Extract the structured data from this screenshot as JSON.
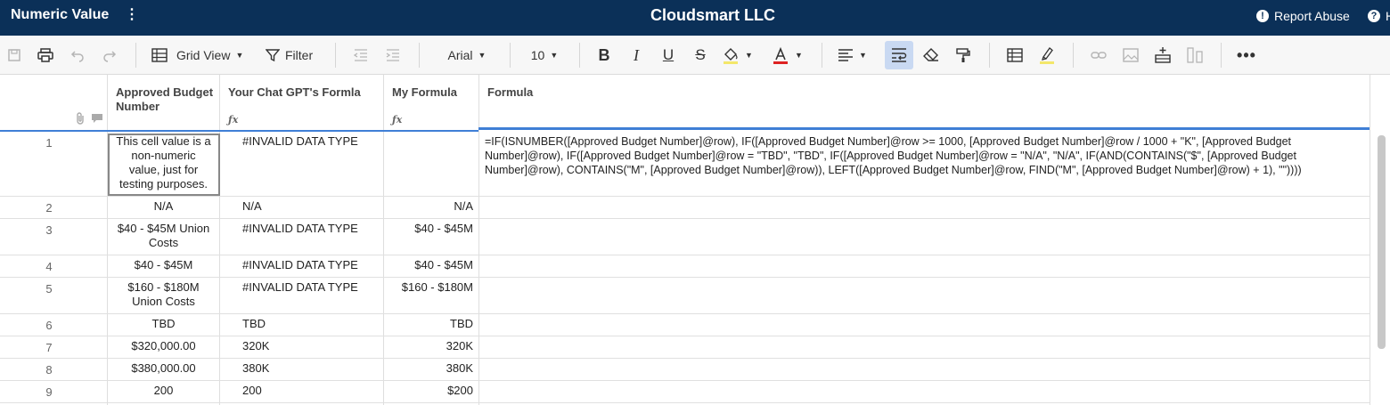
{
  "header": {
    "sheet_name": "Numeric Value",
    "company": "Cloudsmart LLC",
    "report_abuse": "Report Abuse",
    "help_letter": "H"
  },
  "toolbar": {
    "view_label": "Grid View",
    "filter_label": "Filter",
    "font": "Arial",
    "size": "10"
  },
  "columns": [
    {
      "title_line1": "Approved Budget",
      "title_line2": "Number"
    },
    {
      "title_line1": "Your Chat GPT's Formla"
    },
    {
      "title_line1": "My Formula"
    },
    {
      "title_line1": "Formula"
    }
  ],
  "rows": [
    {
      "num": "1",
      "c1": [
        "This cell value is a",
        "non-numeric",
        "value, just for",
        "testing purposes."
      ],
      "c2": "#INVALID DATA TYPE",
      "c3": "",
      "c4": [
        "=IF(ISNUMBER([Approved Budget Number]@row), IF([Approved Budget Number]@row >= 1000, [Approved Budget Number]@row / 1000 + \"K\", [Approved Budget",
        "Number]@row), IF([Approved Budget Number]@row = \"TBD\", \"TBD\", IF([Approved Budget Number]@row = \"N/A\", \"N/A\", IF(AND(CONTAINS(\"$\", [Approved Budget",
        "Number]@row), CONTAINS(\"M\", [Approved Budget Number]@row)), LEFT([Approved Budget Number]@row, FIND(\"M\", [Approved Budget Number]@row) + 1), \"\"))))"
      ]
    },
    {
      "num": "2",
      "c1": [
        "N/A"
      ],
      "c2": "N/A",
      "c3": "N/A"
    },
    {
      "num": "3",
      "c1": [
        "$40 - $45M Union",
        "Costs"
      ],
      "c2": "#INVALID DATA TYPE",
      "c3": "$40 - $45M"
    },
    {
      "num": "4",
      "c1": [
        "$40 - $45M"
      ],
      "c2": "#INVALID DATA TYPE",
      "c3": "$40 - $45M"
    },
    {
      "num": "5",
      "c1": [
        "$160 - $180M",
        "Union Costs"
      ],
      "c2": "#INVALID DATA TYPE",
      "c3": "$160 - $180M"
    },
    {
      "num": "6",
      "c1": [
        "TBD"
      ],
      "c2": "TBD",
      "c3": "TBD"
    },
    {
      "num": "7",
      "c1": [
        "$320,000.00"
      ],
      "c2": "320K",
      "c3": "320K"
    },
    {
      "num": "8",
      "c1": [
        "$380,000.00"
      ],
      "c2": "380K",
      "c3": "380K"
    },
    {
      "num": "9",
      "c1": [
        "200"
      ],
      "c2": "200",
      "c3": "$200"
    }
  ],
  "colors": {
    "topbar": "#0b3058",
    "accent": "#3f7fd6",
    "active_button": "#c9d9f2"
  },
  "icons": [
    "save-icon",
    "print-icon",
    "undo-icon",
    "redo-icon",
    "grid-icon",
    "filter-icon",
    "outdent-icon",
    "indent-icon",
    "bold-icon",
    "italic-icon",
    "underline-icon",
    "strikethrough-icon",
    "fill-color-icon",
    "text-color-icon",
    "align-icon",
    "wrap-text-icon",
    "eraser-icon",
    "format-painter-icon",
    "table-icon",
    "highlight-icon",
    "link-icon",
    "image-icon",
    "insert-row-icon",
    "column-icon",
    "more-icon",
    "attachment-icon",
    "comment-icon",
    "function-icon",
    "info-icon",
    "help-icon"
  ]
}
